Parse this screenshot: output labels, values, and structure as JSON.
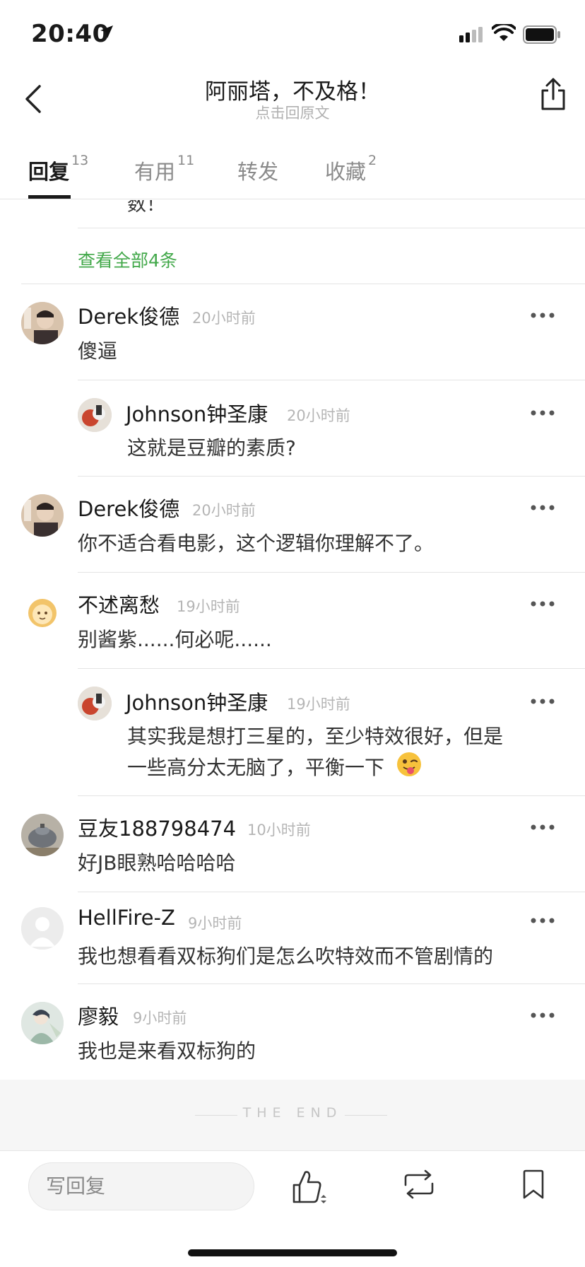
{
  "status_bar": {
    "time": "20:40"
  },
  "nav": {
    "title": "阿丽塔，不及格！",
    "subtitle": "点击回原文"
  },
  "tabs": [
    {
      "label": "回复",
      "count": "13"
    },
    {
      "label": "有用",
      "count": "11"
    },
    {
      "label": "转发",
      "count": ""
    },
    {
      "label": "收藏",
      "count": "2"
    }
  ],
  "partial_text": "数！",
  "view_all": "查看全部4条",
  "comments": [
    {
      "name": "Derek俊德",
      "time": "20小时前",
      "text": "傻逼",
      "avatar_color": "#c7a98e"
    },
    {
      "name": "Johnson钟圣康",
      "time": "20小时前",
      "text": "这就是豆瓣的素质?",
      "avatar_color": "#8d5a46"
    },
    {
      "name": "Derek俊德",
      "time": "20小时前",
      "text": "你不适合看电影，这个逻辑你理解不了。",
      "avatar_color": "#c7a98e"
    },
    {
      "name": "不述离愁",
      "time": "19小时前",
      "text": "别酱紫......何必呢......",
      "avatar_color": "#f2c46a"
    },
    {
      "name": "Johnson钟圣康",
      "time": "19小时前",
      "text_line1": "其实我是想打三星的，至少特效很好，但是",
      "text_line2": "一些高分太无脑了，平衡一下",
      "avatar_color": "#8d5a46"
    },
    {
      "name": "豆友188798474",
      "time": "10小时前",
      "text": "好JB眼熟哈哈哈哈",
      "avatar_color": "#7b7f86"
    },
    {
      "name": "HellFire-Z",
      "time": "9小时前",
      "text": "我也想看看双标狗们是怎么吹特效而不管剧情的",
      "avatar_color": "#ececec"
    },
    {
      "name": "廖毅",
      "time": "9小时前",
      "text": "我也是来看双标狗的",
      "avatar_color": "#9cb8a8"
    }
  ],
  "end_text": "THE END",
  "bottom_bar": {
    "reply_placeholder": "写回复"
  },
  "colors": {
    "accent_green": "#42a84a"
  }
}
